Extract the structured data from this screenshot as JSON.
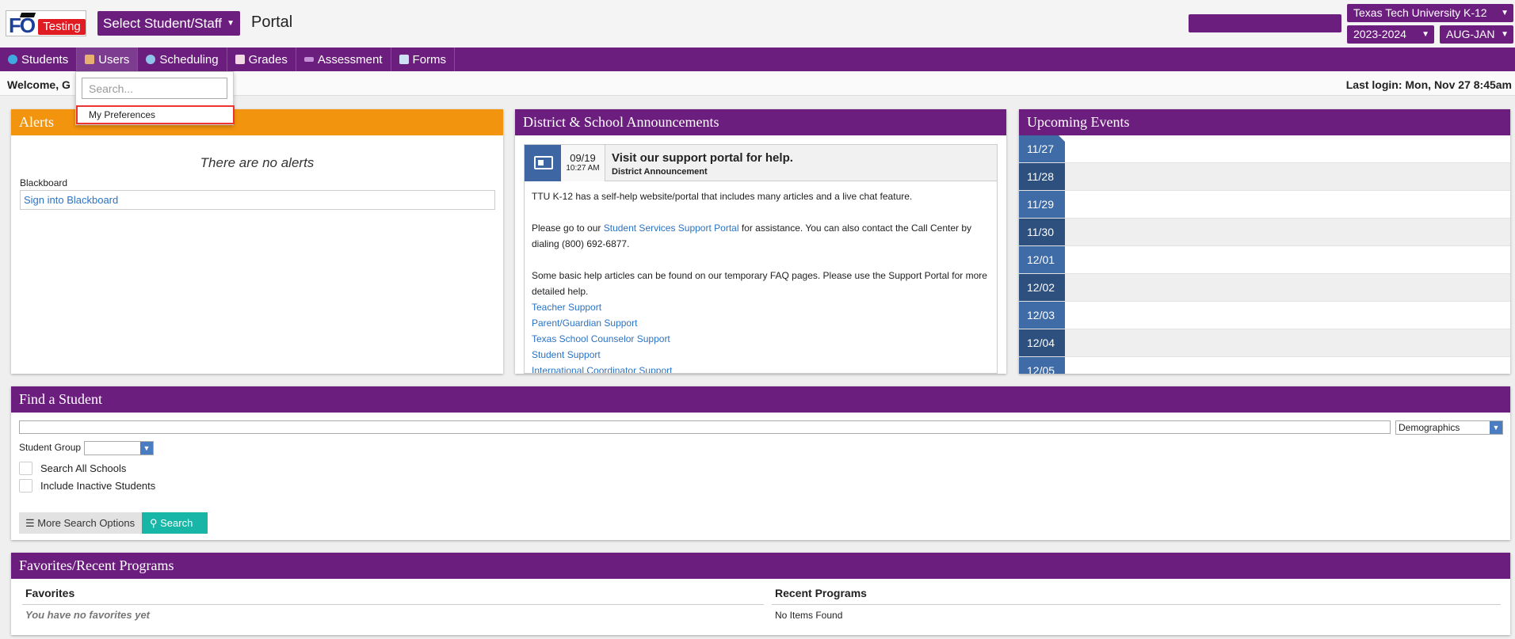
{
  "header": {
    "logo_fo": "FO",
    "logo_testing": "Testing",
    "select_button": "Select Student/Staff",
    "portal_title": "Portal",
    "school": "Texas Tech University K-12",
    "year": "2023-2024",
    "term": "AUG-JAN"
  },
  "nav": {
    "items": [
      "Students",
      "Users",
      "Scheduling",
      "Grades",
      "Assessment",
      "Forms"
    ]
  },
  "welcome": {
    "text": "Welcome, G",
    "last_login": "Last login: Mon, Nov 27 8:45am"
  },
  "users_dropdown": {
    "search_placeholder": "Search...",
    "item": "My Preferences"
  },
  "alerts": {
    "title": "Alerts",
    "empty": "There are no alerts",
    "blackboard_label": "Blackboard",
    "blackboard_link": "Sign into Blackboard"
  },
  "announcements": {
    "title": "District & School Announcements",
    "date": "09/19",
    "time": "10:27 AM",
    "headline": "Visit our support portal for help.",
    "subtitle": "District Announcement",
    "p1": "TTU K-12 has a self-help website/portal that includes many articles and a live chat feature.",
    "p2_pre": "Please go to our ",
    "p2_link": "Student Services Support Portal",
    "p2_post": " for assistance. You can also contact the Call Center by dialing (800) 692-6877.",
    "p3": "Some basic help articles can be found on our temporary FAQ pages. Please use the Support Portal for more detailed help.",
    "links": [
      "Teacher Support",
      "Parent/Guardian Support",
      "Texas School Counselor Support",
      "Student Support",
      "International Coordinator Support"
    ]
  },
  "events": {
    "title": "Upcoming Events",
    "dates": [
      "11/27",
      "11/28",
      "11/29",
      "11/30",
      "12/01",
      "12/02",
      "12/03",
      "12/04",
      "12/05"
    ]
  },
  "find_student": {
    "title": "Find a Student",
    "search_type": "Demographics",
    "group_label": "Student Group",
    "search_all_schools": "Search All Schools",
    "include_inactive": "Include Inactive Students",
    "more_options": "More Search Options",
    "search": "Search"
  },
  "favorites": {
    "title": "Favorites/Recent Programs",
    "favorites_heading": "Favorites",
    "favorites_empty": "You have no favorites yet",
    "recent_heading": "Recent Programs",
    "recent_empty": "No Items Found"
  },
  "colors": {
    "primary_purple": "#6c1e7e",
    "alert_orange": "#f3940f",
    "event_blue": "#3f6ba6",
    "search_teal": "#17b6a6"
  }
}
